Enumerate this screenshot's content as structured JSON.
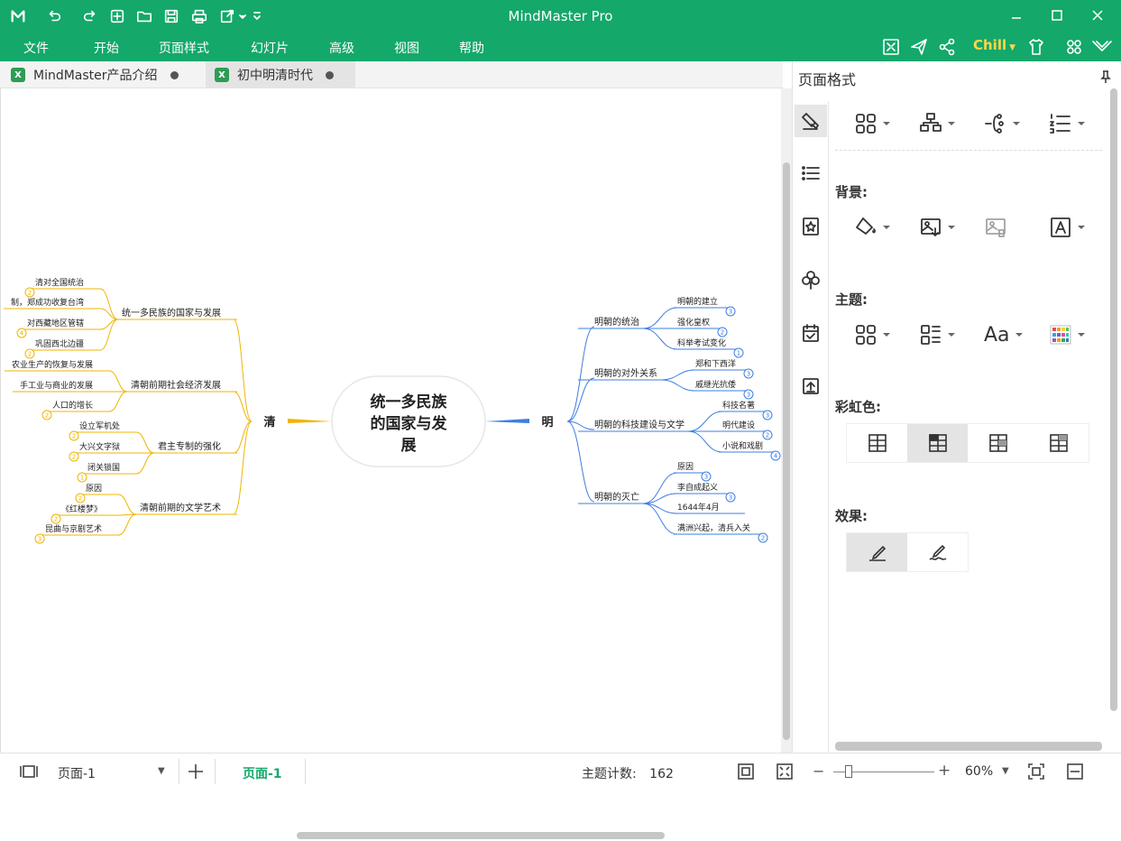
{
  "titlebar": {
    "app_title": "MindMaster Pro",
    "logo_icon": "mindmaster-logo-icon",
    "quick_icons": [
      "undo-icon",
      "redo-icon",
      "new-file-icon",
      "open-folder-icon",
      "save-icon",
      "print-icon",
      "export-icon",
      "more-icon"
    ],
    "window_controls": [
      "minimize-icon",
      "maximize-icon",
      "close-icon"
    ]
  },
  "menubar": {
    "items": [
      "文件",
      "开始",
      "页面样式",
      "幻灯片",
      "高级",
      "视图",
      "帮助"
    ],
    "right_icons": [
      "fit-screen-icon",
      "send-icon",
      "share-icon"
    ],
    "theme_name": "Chill",
    "theme_color": "#ffd84a",
    "extra_icons": [
      "shirt-icon",
      "apps-icon",
      "collapse-ribbon-icon"
    ]
  },
  "tabs": [
    {
      "label": "MindMaster产品介绍",
      "active": false
    },
    {
      "label": "初中明清时代",
      "active": true
    }
  ],
  "mindmap": {
    "central": "统一多民族的国家与发展",
    "central_lines": [
      "统一多民族",
      "的国家与发",
      "展"
    ],
    "left_branch": "清",
    "left_color": "#f0b400",
    "right_branch": "明",
    "right_color": "#3d7fe0",
    "right_groups": [
      {
        "label": "明朝的统治",
        "children": [
          {
            "label": "明朝的建立",
            "badge": "3"
          },
          {
            "label": "强化皇权",
            "badge": "2"
          },
          {
            "label": "科举考试变化",
            "badge": "1"
          }
        ]
      },
      {
        "label": "明朝的对外关系",
        "children": [
          {
            "label": "郑和下西洋",
            "badge": "3"
          },
          {
            "label": "戚继光抗倭",
            "badge": "3"
          }
        ]
      },
      {
        "label": "明朝的科技建设与文学",
        "children": [
          {
            "label": "科技名著",
            "badge": "3"
          },
          {
            "label": "明代建设",
            "badge": "2"
          },
          {
            "label": "小说和戏剧",
            "badge": "4"
          }
        ]
      },
      {
        "label": "明朝的灭亡",
        "children": [
          {
            "label": "原因",
            "badge": "3"
          },
          {
            "label": "李自成起义",
            "badge": "3"
          },
          {
            "label": "1644年4月",
            "badge": ""
          },
          {
            "label": "满洲兴起，清兵入关",
            "badge": "2"
          }
        ]
      }
    ],
    "left_groups": [
      {
        "label": "统一多民族的国家与发展",
        "children": [
          {
            "label": "清对全国统治",
            "badge": "2"
          },
          {
            "label": "制，郑成功收复台湾",
            "badge": ""
          },
          {
            "label": "对西藏地区管辖",
            "badge": "4"
          },
          {
            "label": "巩固西北边疆",
            "badge": "2"
          }
        ]
      },
      {
        "label": "清朝前期社会经济发展",
        "children": [
          {
            "label": "农业生产的恢复与发展",
            "badge": ""
          },
          {
            "label": "手工业与商业的发展",
            "badge": ""
          },
          {
            "label": "人口的增长",
            "badge": "2"
          }
        ]
      },
      {
        "label": "君主专制的强化",
        "children": [
          {
            "label": "设立军机处",
            "badge": "2"
          },
          {
            "label": "大兴文字狱",
            "badge": "2"
          },
          {
            "label": "闭关锁国",
            "badge": "1"
          }
        ]
      },
      {
        "label": "清朝前期的文学艺术",
        "children": [
          {
            "label": "原因",
            "badge": "2"
          },
          {
            "label": "《红楼梦》",
            "badge": "2"
          },
          {
            "label": "昆曲与京剧艺术",
            "badge": "3"
          }
        ]
      }
    ]
  },
  "panel": {
    "title": "页面格式",
    "side_icons": [
      "page-format-icon",
      "outline-list-icon",
      "mark-icon",
      "clipart-icon",
      "task-icon",
      "upload-icon"
    ],
    "layout_tools": [
      "layout-icon",
      "structure-icon",
      "connector-icon",
      "numbering-icon"
    ],
    "background_label": "背景:",
    "background_tools": [
      "fill-color-icon",
      "insert-image-icon",
      "remove-image-icon",
      "watermark-icon"
    ],
    "theme_label": "主题:",
    "theme_tools": [
      "theme-layout-icon",
      "theme-style-icon",
      "font-icon",
      "color-palette-icon"
    ],
    "rainbow_label": "彩虹色:",
    "rainbow_options": [
      "rainbow-option-1",
      "rainbow-option-2",
      "rainbow-option-3",
      "rainbow-option-4"
    ],
    "rainbow_selected": 1,
    "effect_label": "效果:",
    "effect_options": [
      "pen-effect-icon",
      "handdrawn-effect-icon"
    ],
    "effect_selected": 0
  },
  "statusbar": {
    "page_select": "页面-1",
    "page_tab": "页面-1",
    "page_tab_color": "#14a86b",
    "topic_count_label": "主题计数:",
    "topic_count": "162",
    "zoom": "60%"
  }
}
